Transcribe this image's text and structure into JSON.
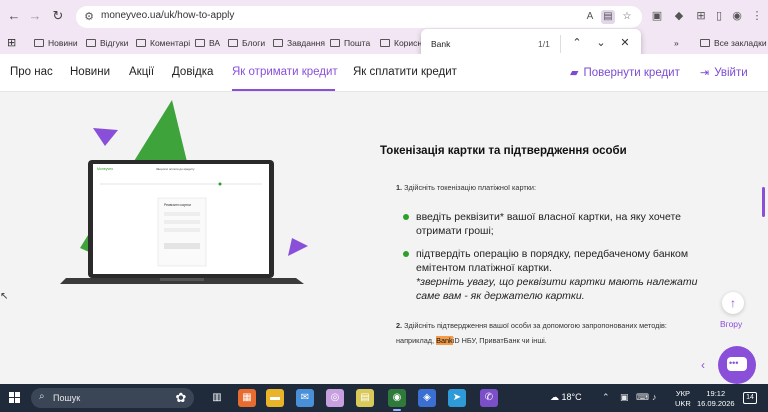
{
  "browser": {
    "url": "moneyveo.ua/uk/how-to-apply",
    "bookmarks": [
      "Новини",
      "Відгуки",
      "Коментарі",
      "ВА",
      "Блоги",
      "Завдання",
      "Пошта",
      "Корисні"
    ],
    "all_bookmarks_label": "Все закладки",
    "find": {
      "query": "Bank",
      "count": "1/1"
    }
  },
  "nav": {
    "items": [
      "Про нас",
      "Новини",
      "Акції",
      "Довідка",
      "Як отримати кредит",
      "Як сплатити кредит"
    ],
    "active_index": 4,
    "return_credit": "Повернути кредит",
    "login": "Увійти"
  },
  "main": {
    "title": "Токенізація картки та підтвердження особи",
    "step1_num": "1.",
    "step1_text": "Здійсніть токенізацію платіжної картки:",
    "bullet1": "введіть реквізити* вашої власної картки, на яку хочете отримати гроші;",
    "bullet2": "підтвердіть операцію в порядку, передбаченому банком емітентом платіжної картки.",
    "bullet2_note": "*зверніть увагу, що реквізити картки мають належати саме вам - як держателю картки.",
    "step2_num": "2.",
    "step2_text": "Здійсніть підтвердження вашої особи за допомогою запропонованих методів:",
    "step2_line2_pre": "наприклад, ",
    "step2_highlight": "Bank",
    "step2_line2_post": "iD НБУ, ПриватБанк чи інші.",
    "up_label": "Вгору",
    "laptop_screen": {
      "brand": "Moneyveo",
      "header": "Зворотні оплати до кредиту",
      "card_title": "Реквізити картки"
    }
  },
  "taskbar": {
    "search_placeholder": "Пошук",
    "weather": "18°C",
    "lang_top": "УКР",
    "lang_bottom": "UKR",
    "time": "19:12",
    "date": "16.09.2026",
    "notifications": "14"
  },
  "colors": {
    "accent": "#8a4fd8",
    "green": "#2ea02a",
    "highlight": "#f39c4a"
  }
}
